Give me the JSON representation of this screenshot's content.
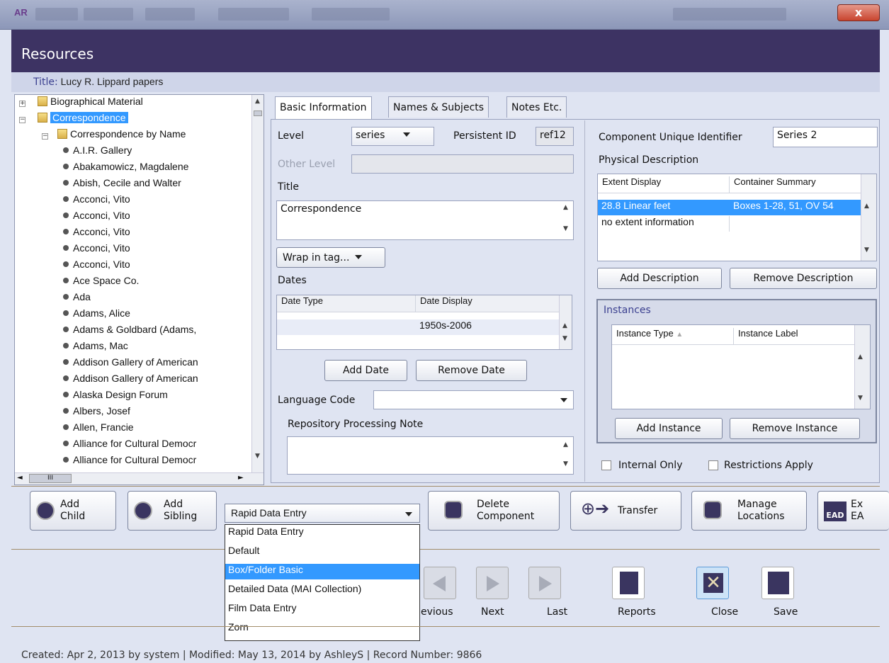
{
  "window": {
    "close_glyph": "x"
  },
  "header": {
    "title": "Resources"
  },
  "record": {
    "title_label": "Title:",
    "title_value": "Lucy R. Lippard papers"
  },
  "tree": {
    "top_items": [
      {
        "label": "Biographical Material"
      },
      {
        "label": "Correspondence"
      }
    ],
    "subfolder": "Correspondence by Name",
    "leaves": [
      "A.I.R. Gallery",
      "Abakamowicz, Magdalene",
      "Abish, Cecile and Walter",
      "Acconci, Vito",
      "Acconci, Vito",
      "Acconci, Vito",
      "Acconci, Vito",
      "Acconci, Vito",
      "Ace Space Co.",
      "Ada",
      "Adams, Alice",
      "Adams & Goldbard (Adams,",
      "Adams, Mac",
      "Addison Gallery of American",
      "Addison Gallery of American",
      "Alaska Design Forum",
      "Albers, Josef",
      "Allen, Francie",
      "Alliance for Cultural Democr",
      "Alliance for Cultural Democr"
    ],
    "hscroll_grip": "III"
  },
  "tabs": [
    "Basic Information",
    "Names & Subjects",
    "Notes Etc."
  ],
  "basic": {
    "level_label": "Level",
    "level_value": "series",
    "persistent_id_label": "Persistent ID",
    "persistent_id_value": "ref12",
    "other_level_label": "Other Level",
    "title_label": "Title",
    "title_value": "Correspondence",
    "wrap_label": "Wrap in tag...",
    "dates_label": "Dates",
    "dates_columns": [
      "Date Type",
      "Date Display"
    ],
    "dates_rows": [
      [
        "",
        "1950s-2006"
      ]
    ],
    "add_date": "Add Date",
    "remove_date": "Remove Date",
    "language_label": "Language Code",
    "repo_note_label": "Repository Processing Note",
    "cuid_label": "Component Unique Identifier",
    "cuid_value": "Series 2",
    "physdesc_label": "Physical Description",
    "extent_columns": [
      "Extent Display",
      "Container Summary"
    ],
    "extent_rows": [
      [
        "28.8 Linear feet",
        "Boxes 1-28, 51, OV 54"
      ],
      [
        "no extent information",
        ""
      ]
    ],
    "add_description": "Add Description",
    "remove_description": "Remove Description",
    "instances_label": "Instances",
    "instance_columns": [
      "Instance Type",
      "Instance Label"
    ],
    "add_instance": "Add Instance",
    "remove_instance": "Remove Instance",
    "internal_only": "Internal Only",
    "restrictions_apply": "Restrictions Apply"
  },
  "actions": {
    "add_child": [
      "Add",
      "Child"
    ],
    "add_sibling": [
      "Add",
      "Sibling"
    ],
    "template_selected": "Rapid Data Entry",
    "template_options": [
      "Rapid Data Entry",
      "Default",
      "Box/Folder Basic",
      "Detailed Data (MAI Collection)",
      "Film Data Entry",
      "Zorn"
    ],
    "template_highlighted": "Box/Folder Basic",
    "delete_component": [
      "Delete",
      "Component"
    ],
    "transfer": "Transfer",
    "manage_locations": [
      "Manage",
      "Locations"
    ],
    "export_ead": [
      "Ex",
      "EA"
    ],
    "export_icon_text": "EAD"
  },
  "nav": {
    "previous": "evious",
    "next": "Next",
    "last": "Last",
    "reports": "Reports",
    "close": "Close",
    "save": "Save"
  },
  "status": "Created: Apr 2, 2013 by system | Modified: May 13, 2014 by AshleyS | Record Number: 9866",
  "colors": {
    "header_bg": "#3d3363",
    "selection": "#3399ff"
  }
}
